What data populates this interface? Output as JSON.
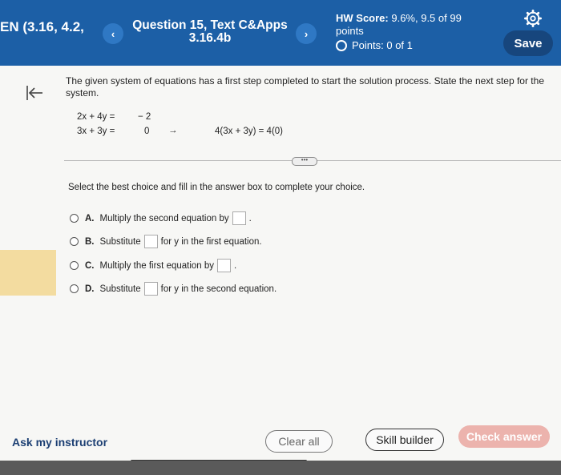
{
  "header": {
    "assignment_title": "EN (3.16, 4.2,",
    "prev_icon": "chevron-left-icon",
    "next_icon": "chevron-right-icon",
    "question_line1": "Question 15, Text C&Apps",
    "question_line2": "3.16.4b",
    "hw_score_label": "HW Score:",
    "hw_score_value": "9.6%, 9.5 of 99",
    "hw_score_unit": "points",
    "points_text": "Points: 0 of 1",
    "save_label": "Save",
    "colors": {
      "bar": "#1c5fa6",
      "save": "#17467d"
    }
  },
  "problem": {
    "prompt": "The given system of equations has a first step completed to start the solution process. State the next step for the system.",
    "eq1": {
      "lhs": "2x + 4y =",
      "rhs": "− 2"
    },
    "eq2": {
      "lhs": "3x + 3y =",
      "rhs": "0"
    },
    "arrow": "→",
    "step": "4(3x + 3y) = 4(0)",
    "more": "•••"
  },
  "instruction": "Select the best choice and fill in the answer box to complete your choice.",
  "choices": [
    {
      "letter": "A.",
      "before": "Multiply the second equation by",
      "after": "."
    },
    {
      "letter": "B.",
      "before": "Substitute",
      "after": "for y in the first equation."
    },
    {
      "letter": "C.",
      "before": "Multiply the first equation by",
      "after": "."
    },
    {
      "letter": "D.",
      "before": "Substitute",
      "after": "for y in the second equation."
    }
  ],
  "footer": {
    "ask_label": "Ask my instructor",
    "clear_label": "Clear all",
    "skill_label": "Skill builder",
    "check_label": "Check answer",
    "colors": {
      "check": "#ecb3ad",
      "ask": "#1c3f73"
    }
  }
}
